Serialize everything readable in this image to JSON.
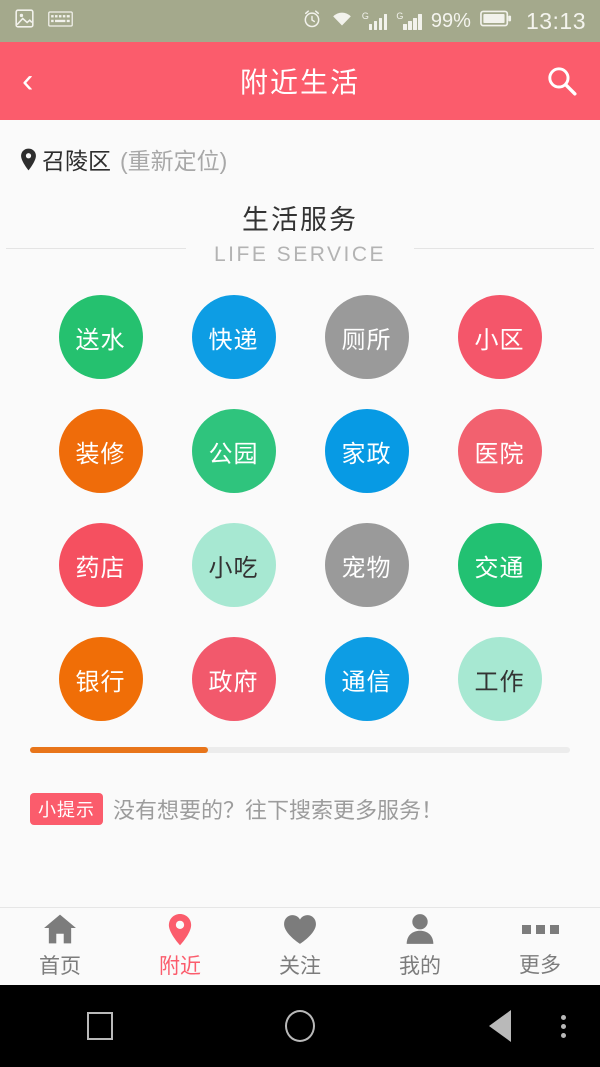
{
  "statusbar": {
    "left_icons": [
      "screenshot-icon",
      "keyboard-icon"
    ],
    "alarm_icon": "alarm-icon",
    "wifi_icon": "wifi-icon",
    "signal_labels": [
      "G",
      "G"
    ],
    "battery_percent": "99%",
    "clock": "13:13",
    "bg_color": "#a4a98c"
  },
  "appbar": {
    "back_icon": "chevron-left-icon",
    "title": "附近生活",
    "search_icon": "search-icon",
    "bg_color": "#fb5c6c"
  },
  "location": {
    "pin_icon": "location-pin-icon",
    "city": "召陵区",
    "relocate": "(重新定位)"
  },
  "section": {
    "title_cn": "生活服务",
    "title_en": "LIFE SERVICE"
  },
  "grid": {
    "items": [
      {
        "label": "送水",
        "bg": "#25c16f",
        "fg": "#ffffff"
      },
      {
        "label": "快递",
        "bg": "#0d9de4",
        "fg": "#ffffff"
      },
      {
        "label": "厕所",
        "bg": "#9a9a9a",
        "fg": "#ffffff"
      },
      {
        "label": "小区",
        "bg": "#f4566a",
        "fg": "#ffffff"
      },
      {
        "label": "装修",
        "bg": "#ef6c0a",
        "fg": "#ffffff"
      },
      {
        "label": "公园",
        "bg": "#2fc47d",
        "fg": "#ffffff"
      },
      {
        "label": "家政",
        "bg": "#079ae4",
        "fg": "#ffffff"
      },
      {
        "label": "医院",
        "bg": "#f2616f",
        "fg": "#ffffff"
      },
      {
        "label": "药店",
        "bg": "#f55060",
        "fg": "#ffffff"
      },
      {
        "label": "小吃",
        "bg": "#a7e8d2",
        "fg": "#333333"
      },
      {
        "label": "宠物",
        "bg": "#9a9a9a",
        "fg": "#ffffff"
      },
      {
        "label": "交通",
        "bg": "#22c172",
        "fg": "#ffffff"
      },
      {
        "label": "银行",
        "bg": "#f06e07",
        "fg": "#ffffff"
      },
      {
        "label": "政府",
        "bg": "#f2596c",
        "fg": "#ffffff"
      },
      {
        "label": "通信",
        "bg": "#0d9de4",
        "fg": "#ffffff"
      },
      {
        "label": "工作",
        "bg": "#a7e8d2",
        "fg": "#333333"
      }
    ]
  },
  "progress": {
    "percent": 33,
    "fill_color": "#e8751a",
    "track_color": "#ececec"
  },
  "tip": {
    "badge": "小提示",
    "text": "没有想要的？往下搜索更多服务！",
    "badge_color": "#fb5c6c"
  },
  "tabbar": {
    "active_color": "#fb5c6c",
    "items": [
      {
        "label": "首页",
        "icon": "home-icon",
        "active": false
      },
      {
        "label": "附近",
        "icon": "location-pin-icon",
        "active": true
      },
      {
        "label": "关注",
        "icon": "heart-icon",
        "active": false
      },
      {
        "label": "我的",
        "icon": "person-icon",
        "active": false
      },
      {
        "label": "更多",
        "icon": "ellipsis-icon",
        "active": false
      }
    ]
  },
  "navbar": {
    "recents_icon": "square-recents-icon",
    "home_icon": "circle-home-icon",
    "back_icon": "triangle-back-icon",
    "menu_icon": "kebab-menu-icon"
  }
}
